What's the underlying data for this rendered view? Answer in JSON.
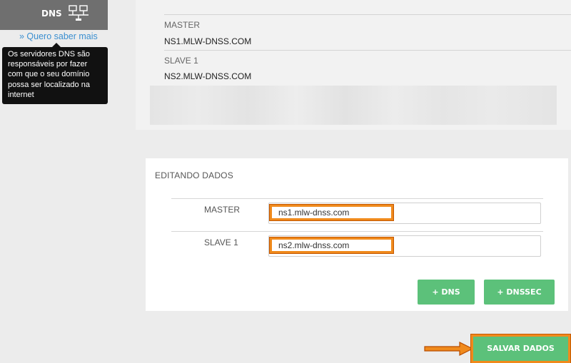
{
  "sidebar": {
    "title": "DNS",
    "icon": "network-icon",
    "more_link": "» Quero saber mais",
    "tooltip_lines": [
      "Os servidores DNS são",
      "responsáveis por fazer",
      "com que o seu domínio",
      "possa ser localizado na",
      "internet"
    ]
  },
  "info": {
    "master_label": "MASTER",
    "master_value": "NS1.MLW-DNSS.COM",
    "slave_label": "SLAVE 1",
    "slave_value": "NS2.MLW-DNSS.COM"
  },
  "edit": {
    "title": "EDITANDO DADOS",
    "master_label": "MASTER",
    "master_value": "ns1.mlw-dnss.com",
    "slave_label": "SLAVE 1",
    "slave_value": "ns2.mlw-dnss.com",
    "add_dns_label": "+ DNS",
    "add_dnssec_label": "+ DNSSEC"
  },
  "save_label": "SALVAR DADOS",
  "colors": {
    "accent_green": "#5cc17a",
    "highlight_orange": "#f08a1c",
    "link_blue": "#3b8fd0",
    "sidebar_gray": "#6f6f6f"
  }
}
